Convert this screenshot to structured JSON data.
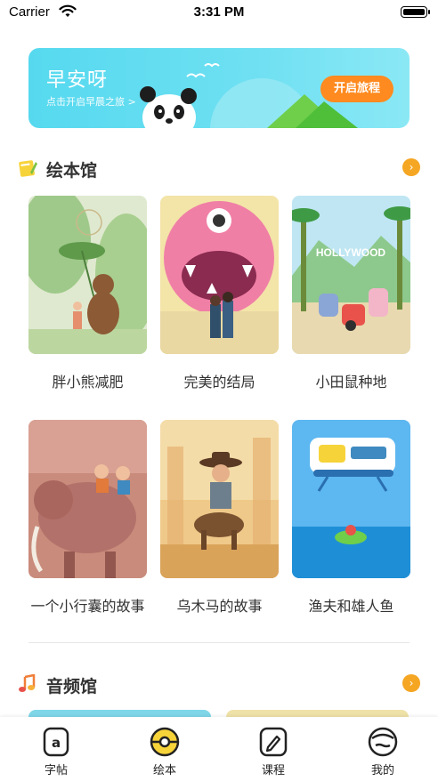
{
  "status_bar": {
    "carrier": "Carrier",
    "time": "3:31 PM"
  },
  "banner": {
    "title": "早安呀",
    "subtitle": "点击开启早晨之旅 >",
    "button_label": "开启旅程"
  },
  "picture_books": {
    "title": "绘本馆",
    "more_icon": "chevron-right-icon",
    "books": [
      {
        "name": "胖小熊减肥"
      },
      {
        "name": "完美的结局"
      },
      {
        "name": "小田鼠种地"
      },
      {
        "name": "一个小行囊的故事"
      },
      {
        "name": "乌木马的故事"
      },
      {
        "name": "渔夫和雄人鱼"
      }
    ]
  },
  "audio": {
    "title": "音频馆",
    "more_icon": "chevron-right-icon"
  },
  "cover_texts": {
    "hollywood": "HOLLYWOOD"
  },
  "tabs": [
    {
      "label": "字帖",
      "icon": "copybook-icon"
    },
    {
      "label": "绘本",
      "icon": "picture-book-icon",
      "active": true
    },
    {
      "label": "课程",
      "icon": "course-pen-icon"
    },
    {
      "label": "我的",
      "icon": "profile-icon"
    }
  ],
  "colors": {
    "accent": "#f5a623",
    "banner": "#56d9ef",
    "banner_button": "#ff8a1f",
    "active_tab": "#f7d33a"
  }
}
